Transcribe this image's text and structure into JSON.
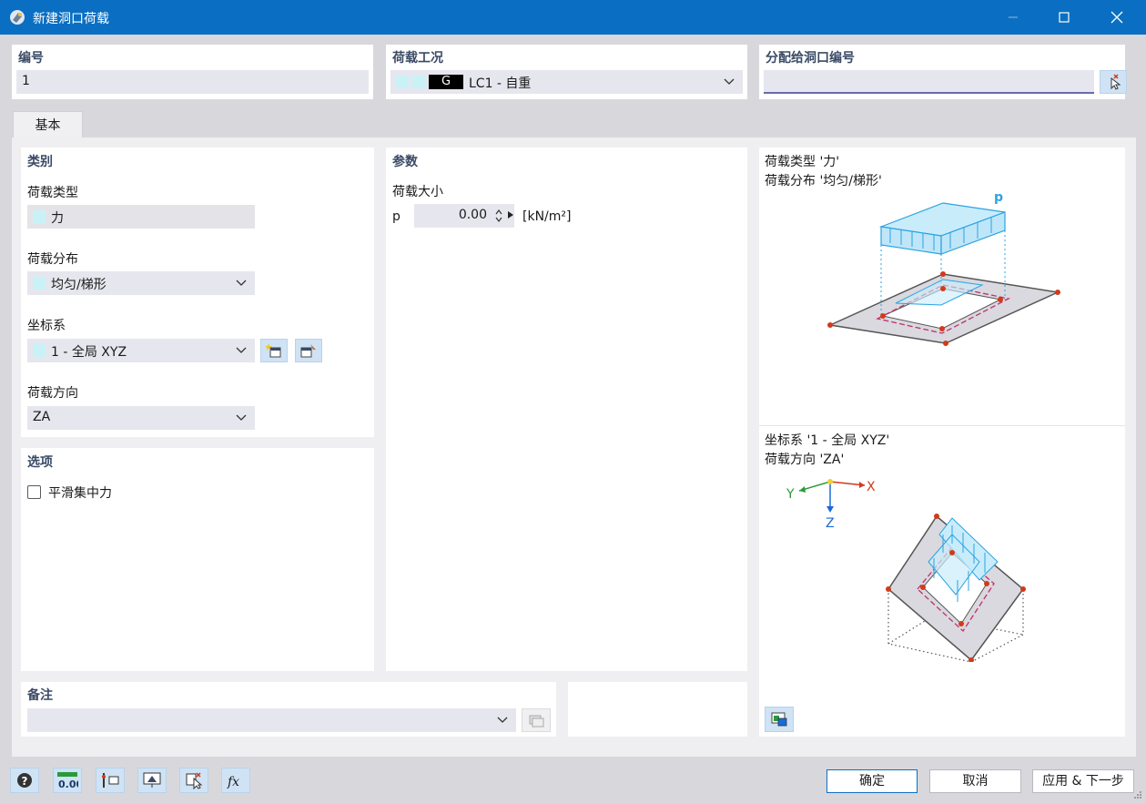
{
  "window": {
    "title": "新建洞口荷载"
  },
  "header": {
    "number_label": "编号",
    "number_value": "1",
    "load_case_label": "荷载工况",
    "load_case_badge": "G",
    "load_case_value": "LC1 - 自重",
    "assign_label": "分配给洞口编号",
    "assign_value": ""
  },
  "tabs": [
    {
      "label": "基本"
    }
  ],
  "category": {
    "title": "类别",
    "load_type_label": "荷载类型",
    "load_type_value": "力",
    "distribution_label": "荷载分布",
    "distribution_value": "均匀/梯形",
    "coord_label": "坐标系",
    "coord_value": "1 - 全局 XYZ",
    "direction_label": "荷载方向",
    "direction_value": "ZA"
  },
  "options": {
    "title": "选项",
    "smooth_label": "平滑集中力",
    "smooth_checked": false
  },
  "parameters": {
    "title": "参数",
    "magnitude_label": "荷载大小",
    "p_symbol": "p",
    "p_value": "0.00",
    "p_unit": "[kN/m²]"
  },
  "preview": {
    "top_line1": "荷载类型 '力'",
    "top_line2": "荷载分布 '均匀/梯形'",
    "top_p_label": "p",
    "bottom_line1": "坐标系 '1 - 全局 XYZ'",
    "bottom_line2": "荷载方向 'ZA'",
    "axis_x": "X",
    "axis_y": "Y",
    "axis_z": "Z"
  },
  "comment": {
    "title": "备注",
    "value": ""
  },
  "footer": {
    "ok": "确定",
    "cancel": "取消",
    "apply_next": "应用 & 下一步"
  },
  "colors": {
    "titlebar": "#0a6fc2",
    "accent_blue": "#2aa3e3",
    "load_cyan": "#c9f2f7",
    "node_red": "#d13a1a",
    "dash_magenta": "#c0306a"
  }
}
